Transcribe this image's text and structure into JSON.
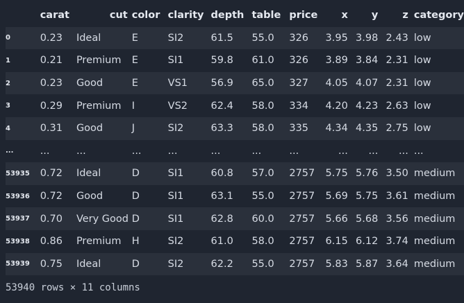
{
  "dataframe": {
    "columns": [
      "carat",
      "cut",
      "color",
      "clarity",
      "depth",
      "table",
      "price",
      "x",
      "y",
      "z",
      "category"
    ],
    "rows": [
      {
        "index": "0",
        "cells": [
          "0.23",
          "Ideal",
          "E",
          "SI2",
          "61.5",
          "55.0",
          "326",
          "3.95",
          "3.98",
          "2.43",
          "low"
        ]
      },
      {
        "index": "1",
        "cells": [
          "0.21",
          "Premium",
          "E",
          "SI1",
          "59.8",
          "61.0",
          "326",
          "3.89",
          "3.84",
          "2.31",
          "low"
        ]
      },
      {
        "index": "2",
        "cells": [
          "0.23",
          "Good",
          "E",
          "VS1",
          "56.9",
          "65.0",
          "327",
          "4.05",
          "4.07",
          "2.31",
          "low"
        ]
      },
      {
        "index": "3",
        "cells": [
          "0.29",
          "Premium",
          "I",
          "VS2",
          "62.4",
          "58.0",
          "334",
          "4.20",
          "4.23",
          "2.63",
          "low"
        ]
      },
      {
        "index": "4",
        "cells": [
          "0.31",
          "Good",
          "J",
          "SI2",
          "63.3",
          "58.0",
          "335",
          "4.34",
          "4.35",
          "2.75",
          "low"
        ]
      },
      {
        "index": "...",
        "cells": [
          "...",
          "...",
          "...",
          "...",
          "...",
          "...",
          "...",
          "...",
          "...",
          "...",
          "..."
        ]
      },
      {
        "index": "53935",
        "cells": [
          "0.72",
          "Ideal",
          "D",
          "SI1",
          "60.8",
          "57.0",
          "2757",
          "5.75",
          "5.76",
          "3.50",
          "medium"
        ]
      },
      {
        "index": "53936",
        "cells": [
          "0.72",
          "Good",
          "D",
          "SI1",
          "63.1",
          "55.0",
          "2757",
          "5.69",
          "5.75",
          "3.61",
          "medium"
        ]
      },
      {
        "index": "53937",
        "cells": [
          "0.70",
          "Very Good",
          "D",
          "SI1",
          "62.8",
          "60.0",
          "2757",
          "5.66",
          "5.68",
          "3.56",
          "medium"
        ]
      },
      {
        "index": "53938",
        "cells": [
          "0.86",
          "Premium",
          "H",
          "SI2",
          "61.0",
          "58.0",
          "2757",
          "6.15",
          "6.12",
          "3.74",
          "medium"
        ]
      },
      {
        "index": "53939",
        "cells": [
          "0.75",
          "Ideal",
          "D",
          "SI2",
          "62.2",
          "55.0",
          "2757",
          "5.83",
          "5.87",
          "3.64",
          "medium"
        ]
      }
    ],
    "footer": "53940 rows × 11 columns"
  }
}
